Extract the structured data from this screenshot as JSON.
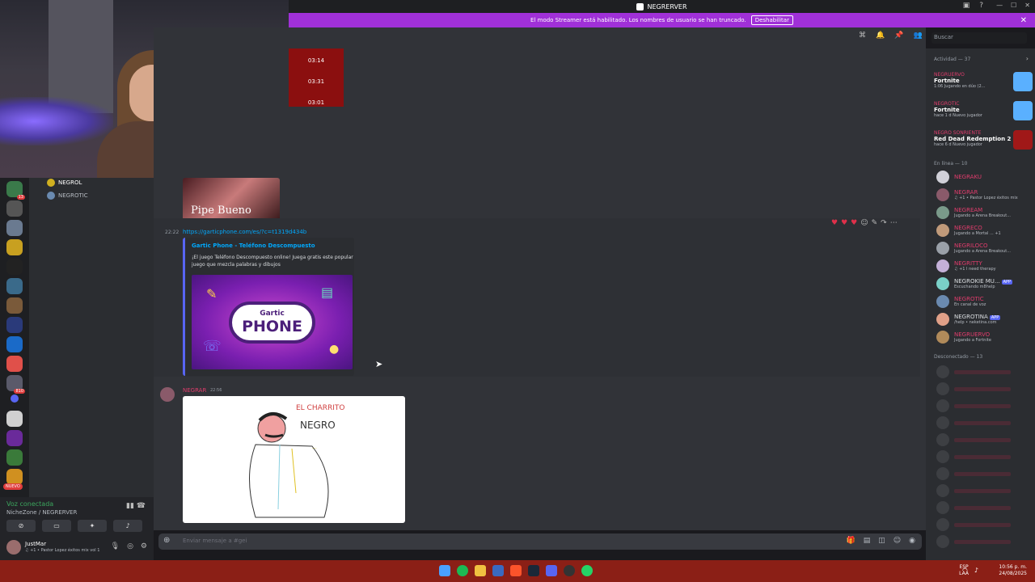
{
  "window": {
    "title": "NEGRERVER"
  },
  "banner": {
    "text": "El modo Streamer está habilitado. Los nombres de usuario se han truncado.",
    "button_label": "Deshabilitar"
  },
  "search": {
    "placeholder": "Buscar"
  },
  "timestamps_box": [
    "03:14",
    "03:31",
    "03:01"
  ],
  "image_caption": "Pipe Bueno",
  "voice_channel_users": [
    {
      "name": "NEGROL",
      "color": "#ffffff"
    },
    {
      "name": "NEGROTIC",
      "color": "#b5bac1"
    }
  ],
  "voice_panel": {
    "status": "Voz conectada",
    "location": "NicheZone / NEGRERVER"
  },
  "user_panel": {
    "name": "JustMar",
    "status": "♫ +1 • Pastor Lopez éxitos mix vol 1"
  },
  "server_badges": [
    "13",
    "810",
    "NUEVO"
  ],
  "message1": {
    "timestamp": "22:22",
    "link": "https://garticphone.com/es/?c=t1319d434b",
    "embed_title": "Gartic Phone - Teléfono Descompuesto",
    "embed_desc": "¡El juego Teléfono Descompuesto online! Juega gratis este popular juego que mezcla palabras y dibujos",
    "logo_top": "Gartic",
    "logo_bottom": "PHONE"
  },
  "message2": {
    "user": "NEGRAR",
    "timestamp": "22:56",
    "drawing_text": [
      "EL CHARRITO",
      "NEGRO"
    ]
  },
  "input": {
    "placeholder": "Enviar mensaje a #gei"
  },
  "members": {
    "activity_header": "Actividad — 37",
    "activities": [
      {
        "user": "NEGRUERVO",
        "game": "Fortnite",
        "status": "1:06  Jugando en dúo (2...",
        "thumb_color": "#5ab0ff"
      },
      {
        "user": "NEGROTIC",
        "game": "Fortnite",
        "status": "hace 1 d   Nuevo jugador",
        "thumb_color": "#5ab0ff"
      },
      {
        "user": "NEGRO SONRIENTE",
        "game": "Red Dead Redemption 2",
        "status": "hace 6 d   Nuevo jugador",
        "thumb_color": "#a01818"
      }
    ],
    "online_header": "En línea — 10",
    "online": [
      {
        "name": "NEGRAKU",
        "status": "",
        "color": "#e03c6c",
        "av": "#d0d0d8"
      },
      {
        "name": "NEGRAR",
        "status": "♫ +1 • Pastor Lopez éxitos mix",
        "color": "#e03c6c",
        "av": "#8a5a6a"
      },
      {
        "name": "NEGREAM",
        "status": "Jugando a Arena Breakout...",
        "color": "#e03c6c",
        "av": "#7a9a8a"
      },
      {
        "name": "NEGRECO",
        "status": "Jugando a Mortal ... +1",
        "color": "#e03c6c",
        "av": "#c09a7a"
      },
      {
        "name": "NEGRILOCO",
        "status": "Jugando a Arena Breakout...",
        "color": "#e03c6c",
        "av": "#9aa0a8"
      },
      {
        "name": "NEGRITTY",
        "status": "♫ +1 I need therapy",
        "color": "#e03c6c",
        "av": "#c4b0d8"
      },
      {
        "name": "NEGROKIE MU...",
        "status": "Escuchando m8help",
        "color": "#dbdee1",
        "av": "#7ad0c8",
        "app": "APP"
      },
      {
        "name": "NEGROTIC",
        "status": "En canal de voz",
        "color": "#e03c6c",
        "av": "#6a8ab0"
      },
      {
        "name": "NEGROTINA",
        "status": "/help • neketina.com",
        "color": "#dbdee1",
        "av": "#e0a088",
        "app": "APP"
      },
      {
        "name": "NEGRUERVO",
        "status": "Jugando a Fortnite",
        "color": "#e03c6c",
        "av": "#b08a5a"
      }
    ],
    "offline_header": "Desconectado — 13"
  },
  "taskbar": {
    "lang_top": "ESP",
    "lang_bottom": "LAA",
    "time": "10:56 p. m.",
    "date": "24/08/2025"
  }
}
